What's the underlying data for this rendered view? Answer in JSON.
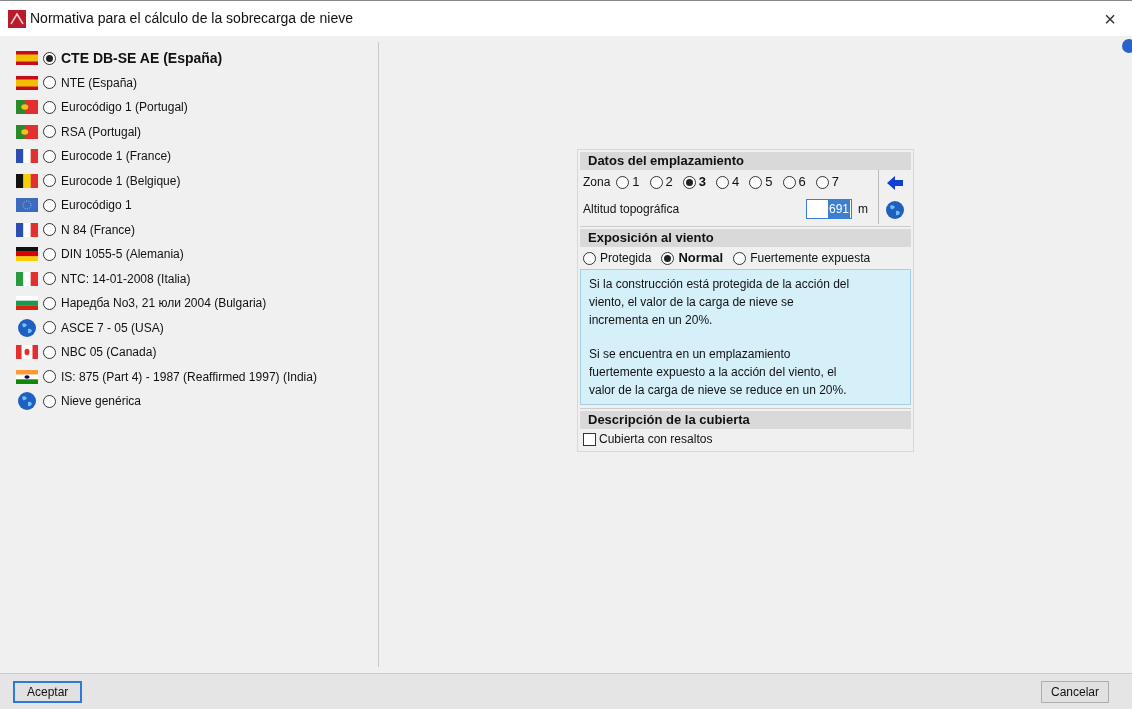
{
  "window": {
    "title": "Normativa para el cálculo de la sobrecarga de nieve",
    "close": "×"
  },
  "codes": [
    {
      "label": "CTE DB-SE AE (España)",
      "kind": "es",
      "selected": true
    },
    {
      "label": "NTE (España)",
      "kind": "es",
      "selected": false
    },
    {
      "label": "Eurocódigo 1 (Portugal)",
      "kind": "pt",
      "selected": false
    },
    {
      "label": "RSA (Portugal)",
      "kind": "pt",
      "selected": false
    },
    {
      "label": "Eurocode 1 (France)",
      "kind": "fr",
      "selected": false
    },
    {
      "label": "Eurocode 1 (Belgique)",
      "kind": "be",
      "selected": false
    },
    {
      "label": "Eurocódigo 1",
      "kind": "eu",
      "selected": false
    },
    {
      "label": "N 84 (France)",
      "kind": "fr",
      "selected": false
    },
    {
      "label": "DIN 1055-5 (Alemania)",
      "kind": "de",
      "selected": false
    },
    {
      "label": "NTC: 14-01-2008  (Italia)",
      "kind": "it",
      "selected": false
    },
    {
      "label": "Наредба No3, 21 юли 2004 (Bulgaria)",
      "kind": "bg",
      "selected": false
    },
    {
      "label": "ASCE 7 - 05 (USA)",
      "kind": "globe",
      "selected": false
    },
    {
      "label": "NBC 05 (Canada)",
      "kind": "ca",
      "selected": false
    },
    {
      "label": "IS: 875 (Part 4) - 1987 (Reaffirmed 1997) (India)",
      "kind": "in",
      "selected": false
    },
    {
      "label": "Nieve genérica",
      "kind": "globe",
      "selected": false
    }
  ],
  "site": {
    "title": "Datos del emplazamiento",
    "zone_label": "Zona",
    "zones": [
      {
        "label": "1",
        "selected": false
      },
      {
        "label": "2",
        "selected": false
      },
      {
        "label": "3",
        "selected": true
      },
      {
        "label": "4",
        "selected": false
      },
      {
        "label": "5",
        "selected": false
      },
      {
        "label": "6",
        "selected": false
      },
      {
        "label": "7",
        "selected": false
      }
    ],
    "altitude_label": "Altitud topográfica",
    "altitude": "691",
    "unit": "m"
  },
  "wind": {
    "title": "Exposición al viento",
    "options": [
      {
        "label": "Protegida",
        "selected": false
      },
      {
        "label": "Normal",
        "selected": true
      },
      {
        "label": "Fuertemente expuesta",
        "selected": false
      }
    ],
    "info": [
      "Si la construcción está protegida de la acción del viento, el valor de la carga de nieve se incrementa en un 20%.",
      "Si se encuentra en un emplazamiento fuertemente expuesto a la acción del viento, el valor de la carga de nieve se reduce en un 20%."
    ]
  },
  "roof": {
    "title": "Descripción de la cubierta",
    "checkbox": {
      "label": "Cubierta con resaltos",
      "checked": false
    }
  },
  "buttons": {
    "accept": "Aceptar",
    "cancel": "Cancelar"
  }
}
